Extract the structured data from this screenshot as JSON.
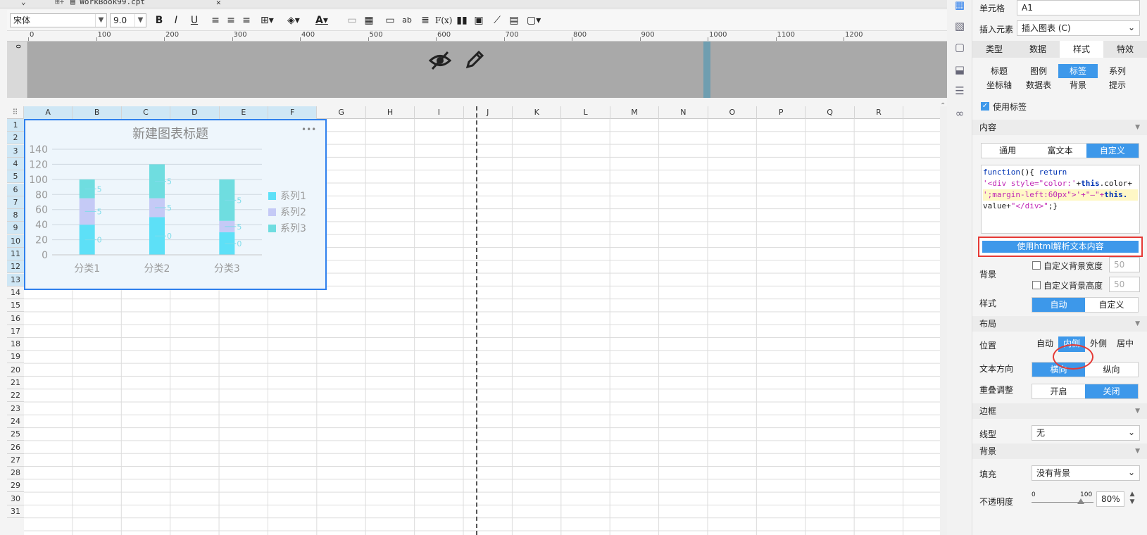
{
  "tab": {
    "file_name": "WorkBook99.cpt"
  },
  "toolbar": {
    "font_name": "宋体",
    "font_size": "9.0",
    "bold": "B",
    "italic": "I",
    "underline": "U",
    "font_color": "A",
    "wrap_label": "ab",
    "formula_label": "F(x)"
  },
  "ruler": {
    "labels": [
      "0",
      "100",
      "200",
      "300",
      "400",
      "500",
      "600",
      "700",
      "800",
      "900",
      "1000",
      "1100",
      "1200"
    ]
  },
  "header_band": {
    "left_label": "0"
  },
  "columns": [
    "A",
    "B",
    "C",
    "D",
    "E",
    "F",
    "G",
    "H",
    "I",
    "J",
    "K",
    "L",
    "M",
    "N",
    "O",
    "P",
    "Q",
    "R"
  ],
  "rows": [
    "1",
    "2",
    "3",
    "4",
    "5",
    "6",
    "7",
    "8",
    "9",
    "10",
    "11",
    "12",
    "13",
    "14",
    "15",
    "16",
    "17",
    "18",
    "19",
    "20",
    "21",
    "22",
    "23",
    "24",
    "25",
    "26",
    "27",
    "28",
    "29",
    "30",
    "31"
  ],
  "chart_data": {
    "type": "bar",
    "stacked": true,
    "title": "新建图表标题",
    "categories": [
      "分类1",
      "分类2",
      "分类3"
    ],
    "series": [
      {
        "name": "系列1",
        "values": [
          40,
          50,
          30
        ],
        "color": "#5de0f7"
      },
      {
        "name": "系列2",
        "values": [
          35,
          25,
          15
        ],
        "color": "#c5caf6"
      },
      {
        "name": "系列3",
        "values": [
          25,
          45,
          55
        ],
        "color": "#6fdde0"
      }
    ],
    "ylim": [
      0,
      140
    ],
    "yticks": [
      "0",
      "20",
      "40",
      "60",
      "80",
      "100",
      "120",
      "140"
    ],
    "labels": [
      {
        "category": "分类1",
        "series": "系列2",
        "text": "5"
      },
      {
        "category": "分类1",
        "series": "系列3",
        "text": "5"
      },
      {
        "category": "分类1",
        "series": "系列1",
        "text": "0"
      },
      {
        "category": "分类2",
        "series": "系列2",
        "text": "5"
      },
      {
        "category": "分类2",
        "series": "系列3",
        "text": "5"
      },
      {
        "category": "分类2",
        "series": "系列1",
        "text": "0"
      },
      {
        "category": "分类3",
        "series": "系列2",
        "text": "5"
      },
      {
        "category": "分类3",
        "series": "系列3",
        "text": "5"
      },
      {
        "category": "分类3",
        "series": "系列1",
        "text": "0"
      }
    ],
    "legend_position": "right",
    "grid": true,
    "menu_glyph": "•••"
  },
  "panel": {
    "cell_label": "单元格",
    "cell_value": "A1",
    "insert_label": "插入元素",
    "insert_value": "插入图表 (C)",
    "main_tabs": [
      "类型",
      "数据",
      "样式",
      "特效"
    ],
    "main_tab_active": "样式",
    "sub_tabs_row1": [
      "标题",
      "图例",
      "标签",
      "系列"
    ],
    "sub_tabs_row2": [
      "坐标轴",
      "数据表",
      "背景",
      "提示"
    ],
    "sub_tab_active": "标签",
    "use_label": "使用标签",
    "content_section": "内容",
    "content_modes": [
      "通用",
      "富文本",
      "自定义"
    ],
    "content_mode_active": "自定义",
    "code_line1_a": "function",
    "code_line1_b": "(){ ",
    "code_line1_c": "return",
    "code_line2_a": "'<div style=\"color:'",
    "code_line2_b": "+",
    "code_line2_c": "this",
    "code_line2_d": ".color+",
    "code_line3_a": "';margin-left:60px\">'",
    "code_line3_b": "+\"—\"+",
    "code_line3_c": "this.",
    "code_line4_a": "value+",
    "code_line4_b": "\"</div>\"",
    "code_line4_c": ";}",
    "html_parse_button": "使用html解析文本内容",
    "bg_label": "背景",
    "custom_bg_width": "自定义背景宽度",
    "custom_bg_height": "自定义背景高度",
    "bg_width_value": "50",
    "bg_height_value": "50",
    "style_label": "样式",
    "style_modes": [
      "自动",
      "自定义"
    ],
    "style_mode_active": "自动",
    "layout_section": "布局",
    "position_label": "位置",
    "position_modes": [
      "自动",
      "内侧",
      "外侧",
      "居中"
    ],
    "position_active": "内侧",
    "text_dir_label": "文本方向",
    "text_dir_modes": [
      "横向",
      "纵向"
    ],
    "text_dir_active": "横向",
    "overlap_label": "重叠调整",
    "overlap_modes": [
      "开启",
      "关闭"
    ],
    "overlap_active": "关闭",
    "border_section": "边框",
    "line_type_label": "线型",
    "line_type_value": "无",
    "bg_section": "背景",
    "fill_label": "填充",
    "fill_value": "没有背景",
    "opacity_label": "不透明度",
    "opacity_min": "0",
    "opacity_max": "100",
    "opacity_value": "80%"
  }
}
